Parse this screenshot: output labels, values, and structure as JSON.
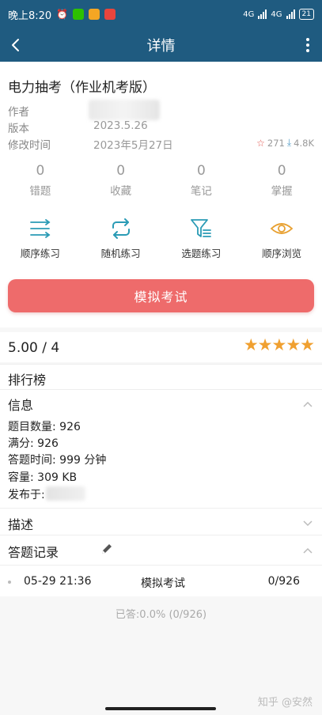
{
  "status_bar": {
    "time": "晚上8:20",
    "network_1": "4G",
    "network_2": "4G",
    "battery": "21"
  },
  "header": {
    "title": "详情"
  },
  "exam": {
    "title": "电力抽考（作业机考版）",
    "author_label": "作者",
    "version_label": "版本",
    "version_value": "2023.5.26",
    "modified_label": "修改时间",
    "modified_value": "2023年5月27日",
    "favorites": "271",
    "downloads": "4.8K"
  },
  "counters": [
    {
      "value": "0",
      "label": "错题"
    },
    {
      "value": "0",
      "label": "收藏"
    },
    {
      "value": "0",
      "label": "笔记"
    },
    {
      "value": "0",
      "label": "掌握"
    }
  ],
  "actions": [
    {
      "label": "顺序练习",
      "icon": "list-lines-icon"
    },
    {
      "label": "随机练习",
      "icon": "shuffle-icon"
    },
    {
      "label": "选题练习",
      "icon": "filter-icon"
    },
    {
      "label": "顺序浏览",
      "icon": "eye-icon"
    }
  ],
  "mock_exam_button": "模拟考试",
  "rating": {
    "score": "5.00 / 4",
    "stars": "★★★★★"
  },
  "ranking": {
    "title": "排行榜"
  },
  "info": {
    "title": "信息",
    "question_count": "题目数量: 926",
    "full_score": "满分: 926",
    "answer_time": "答题时间: 999 分钟",
    "size": "容量: 309 KB",
    "published_by": "发布于:"
  },
  "description": {
    "title": "描述"
  },
  "records": {
    "title": "答题记录",
    "items": [
      {
        "time": "05-29 21:36",
        "type": "模拟考试",
        "score": "0/926"
      }
    ],
    "answered": "已答:0.0% (0/926)"
  },
  "watermark": "知乎 @安然",
  "colors": {
    "header_bg": "#1f5b80",
    "accent": "#2a9bb5",
    "mock_button": "#ee6b6b",
    "stars": "#f0a030"
  }
}
